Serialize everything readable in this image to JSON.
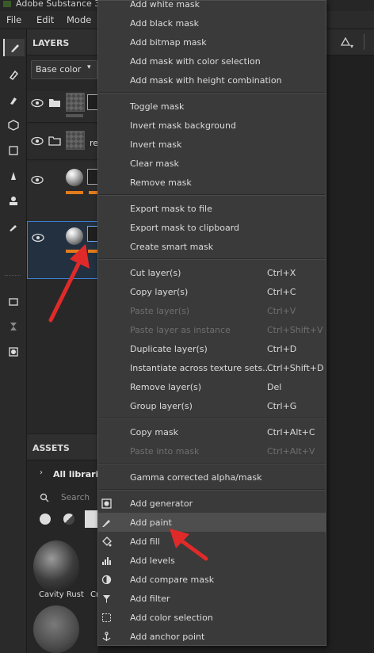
{
  "window": {
    "title": "Adobe Substance 3"
  },
  "menubar": {
    "items": [
      "File",
      "Edit",
      "Mode"
    ]
  },
  "layers_panel": {
    "title": "LAYERS",
    "channel_select": "Base color",
    "layers": [
      {
        "label": ""
      },
      {
        "label": "re"
      },
      {
        "label": ""
      },
      {
        "label": ""
      }
    ]
  },
  "assets_panel": {
    "title": "ASSETS",
    "library": "All librarie",
    "search_placeholder": "Search",
    "items": [
      "Cavity Rust",
      "Cr"
    ]
  },
  "context_menu": {
    "groups": [
      [
        {
          "label": "Add white mask"
        },
        {
          "label": "Add black mask"
        },
        {
          "label": "Add bitmap mask"
        },
        {
          "label": "Add mask with color selection"
        },
        {
          "label": "Add mask with height combination"
        }
      ],
      [
        {
          "label": "Toggle mask"
        },
        {
          "label": "Invert mask background"
        },
        {
          "label": "Invert mask"
        },
        {
          "label": "Clear mask"
        },
        {
          "label": "Remove mask"
        }
      ],
      [
        {
          "label": "Export mask to file"
        },
        {
          "label": "Export mask to clipboard"
        },
        {
          "label": "Create smart mask"
        }
      ],
      [
        {
          "label": "Cut layer(s)",
          "shortcut": "Ctrl+X"
        },
        {
          "label": "Copy layer(s)",
          "shortcut": "Ctrl+C"
        },
        {
          "label": "Paste layer(s)",
          "shortcut": "Ctrl+V",
          "disabled": true
        },
        {
          "label": "Paste layer as instance",
          "shortcut": "Ctrl+Shift+V",
          "disabled": true
        },
        {
          "label": "Duplicate layer(s)",
          "shortcut": "Ctrl+D"
        },
        {
          "label": "Instantiate across texture sets...",
          "shortcut": "Ctrl+Shift+D"
        },
        {
          "label": "Remove layer(s)",
          "shortcut": "Del"
        },
        {
          "label": "Group layer(s)",
          "shortcut": "Ctrl+G"
        }
      ],
      [
        {
          "label": "Copy mask",
          "shortcut": "Ctrl+Alt+C"
        },
        {
          "label": "Paste into mask",
          "shortcut": "Ctrl+Alt+V",
          "disabled": true
        }
      ],
      [
        {
          "label": "Gamma corrected alpha/mask"
        }
      ],
      [
        {
          "label": "Add generator",
          "icon": "generator-icon"
        },
        {
          "label": "Add paint",
          "icon": "paint-brush-icon",
          "highlighted": true
        },
        {
          "label": "Add fill",
          "icon": "fill-bucket-icon"
        },
        {
          "label": "Add levels",
          "icon": "levels-icon"
        },
        {
          "label": "Add compare mask",
          "icon": "compare-mask-icon"
        },
        {
          "label": "Add filter",
          "icon": "filter-icon"
        },
        {
          "label": "Add color selection",
          "icon": "color-selection-icon"
        },
        {
          "label": "Add anchor point",
          "icon": "anchor-icon"
        }
      ]
    ]
  },
  "annotations": {
    "arrow_color": "#e02a2a"
  },
  "colors": {
    "menu_bg": "#3a3a3a",
    "highlight": "#4e4e4e",
    "accent_orange": "#e27b1c",
    "selection_blue": "#3d7fcf"
  }
}
